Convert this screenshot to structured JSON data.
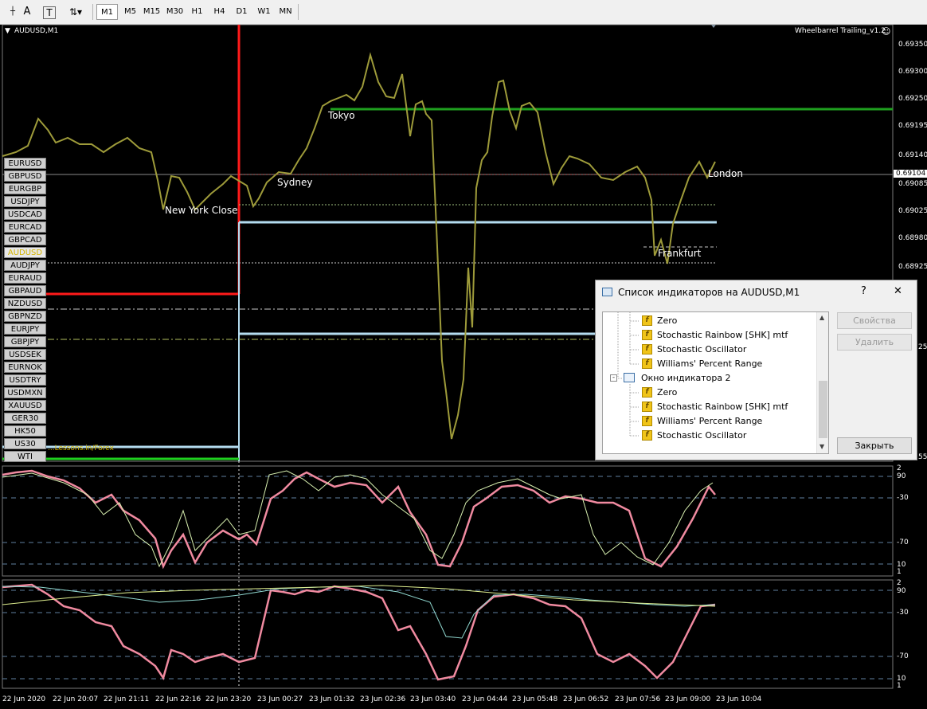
{
  "toolbar": {
    "tool_letter": "A",
    "tool_text": "T",
    "timeframes": [
      "M1",
      "M5",
      "M15",
      "M30",
      "H1",
      "H4",
      "D1",
      "W1",
      "MN"
    ],
    "active_timeframe": "M1"
  },
  "chart": {
    "symbol_title": "AUDUSD,M1",
    "expert_label": "Wheelbarrel Trailing_v1.2",
    "current_price": "0.69104",
    "price_ticks": [
      "0.69350",
      "0.69300",
      "0.69250",
      "0.69195",
      "0.69140",
      "0.69085",
      "0.69025",
      "0.68980",
      "0.68925"
    ],
    "price_ticks_partial": [
      "25",
      "55"
    ],
    "watermark": "...Lessons.in/Forex",
    "sessions": [
      "New York Close",
      "Sydney",
      "Tokyo",
      "London",
      "Frankfurt"
    ],
    "time_ticks": [
      "22 Jun 2020",
      "22 Jun 20:07",
      "22 Jun 21:11",
      "22 Jun 22:16",
      "22 Jun 23:20",
      "23 Jun 00:27",
      "23 Jun 01:32",
      "23 Jun 02:36",
      "23 Jun 03:40",
      "23 Jun 04:44",
      "23 Jun 05:48",
      "23 Jun 06:52",
      "23 Jun 07:56",
      "23 Jun 09:00",
      "23 Jun 10:04"
    ],
    "indicator_levels": [
      "2",
      "90",
      "-30",
      "-70",
      "10",
      "1"
    ]
  },
  "pairs": {
    "items": [
      "EURUSD",
      "GBPUSD",
      "EURGBP",
      "USDJPY",
      "USDCAD",
      "EURCAD",
      "GBPCAD",
      "AUDUSD",
      "AUDJPY",
      "EURAUD",
      "GBPAUD",
      "NZDUSD",
      "GBPNZD",
      "EURJPY",
      "GBPJPY",
      "USDSEK",
      "EURNOK",
      "USDTRY",
      "USDMXN",
      "XAUUSD",
      "GER30",
      "HK50",
      "US30",
      "WTI"
    ],
    "active": "AUDUSD"
  },
  "dialog": {
    "title": "Список индикаторов на AUDUSD,M1",
    "help": "?",
    "close": "✕",
    "window2": "Окно индикатора 2",
    "group1": [
      "Zero",
      "Stochastic Rainbow [SHK] mtf",
      "Stochastic Oscillator",
      "Williams' Percent Range"
    ],
    "group2": [
      "Zero",
      "Stochastic Rainbow [SHK] mtf",
      "Williams' Percent Range",
      "Stochastic Oscillator"
    ],
    "buttons": {
      "properties": "Свойства",
      "delete": "Удалить",
      "close": "Закрыть"
    }
  },
  "colors": {
    "price_up": "#9e9b3a",
    "price_down": "#6a8fd0",
    "red_line": "#ff1a1a",
    "green_line": "#1fa01f",
    "light_blue": "#b4dcf0",
    "pink": "#f08aa0",
    "osc_light": "#d8f0b0"
  }
}
